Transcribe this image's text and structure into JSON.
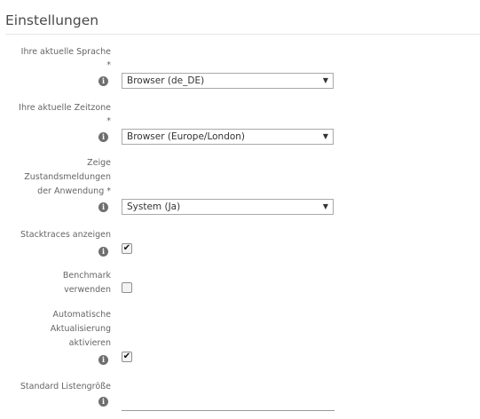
{
  "page": {
    "title": "Einstellungen"
  },
  "fields": {
    "language": {
      "label_line1": "Ihre aktuelle Sprache",
      "required_mark": "*",
      "value": "Browser (de_DE)",
      "info_icon": "info-icon"
    },
    "timezone": {
      "label_line1": "Ihre aktuelle Zeitzone",
      "required_mark": "*",
      "value": "Browser (Europe/London)",
      "info_icon": "info-icon"
    },
    "status_messages": {
      "label_line1": "Zeige",
      "label_line2": "Zustandsmeldungen",
      "label_line3": "der Anwendung *",
      "value": "System (Ja)",
      "info_icon": "info-icon"
    },
    "stacktraces": {
      "label_line1": "Stacktraces anzeigen",
      "checked": true,
      "info_icon": "info-icon"
    },
    "benchmark": {
      "label_line1": "Benchmark",
      "label_line2": "verwenden",
      "checked": false
    },
    "auto_refresh": {
      "label_line1": "Automatische",
      "label_line2": "Aktualisierung",
      "label_line3": "aktivieren",
      "checked": true,
      "info_icon": "info-icon"
    },
    "list_size": {
      "label_line1": "Standard Listengröße",
      "value": "",
      "info_icon": "info-icon"
    }
  },
  "glyphs": {
    "info": "i",
    "caret": "▼",
    "check": "✔"
  }
}
